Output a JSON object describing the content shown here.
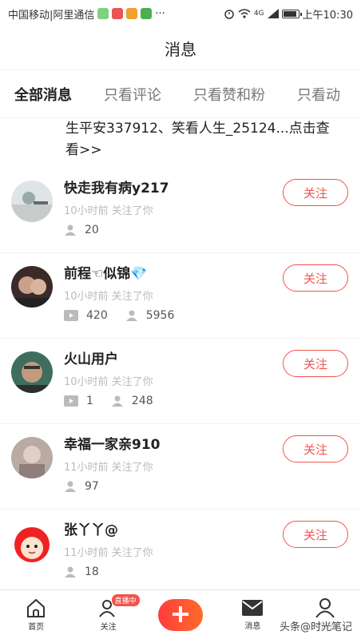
{
  "status_bar": {
    "carrier": "中国移动|阿里通信",
    "dots": "···",
    "network": "4G",
    "time": "上午10:30"
  },
  "header": {
    "title": "消息"
  },
  "tabs": [
    {
      "label": "全部消息",
      "active": true
    },
    {
      "label": "只看评论"
    },
    {
      "label": "只看赞和粉"
    },
    {
      "label": "只看动"
    }
  ],
  "partial_message": {
    "line1": "生平安337912、笑看人生_25124...点击查",
    "line2": "看>>"
  },
  "users": [
    {
      "name": "快走我有病y217",
      "time": "10小时前 关注了你",
      "videos": null,
      "followers": "20",
      "follow_label": "关注"
    },
    {
      "name": "前程☜似锦💎",
      "time": "10小时前 关注了你",
      "videos": "420",
      "followers": "5956",
      "follow_label": "关注"
    },
    {
      "name": "火山用户",
      "time": "10小时前 关注了你",
      "videos": "1",
      "followers": "248",
      "follow_label": "关注"
    },
    {
      "name": "幸福一家亲910",
      "time": "11小时前 关注了你",
      "videos": null,
      "followers": "97",
      "follow_label": "关注"
    },
    {
      "name": "张丫丫@",
      "time": "11小时前 关注了你",
      "videos": null,
      "followers": "18",
      "follow_label": "关注"
    }
  ],
  "bottom_nav": {
    "home": "首页",
    "follow": "关注",
    "live_badge": "直播中",
    "messages": "消息",
    "me": "我的"
  },
  "watermark": "头条@时光笔记",
  "colors": {
    "accent": "#f2534b",
    "tab_highlight": "#ffd24a"
  }
}
